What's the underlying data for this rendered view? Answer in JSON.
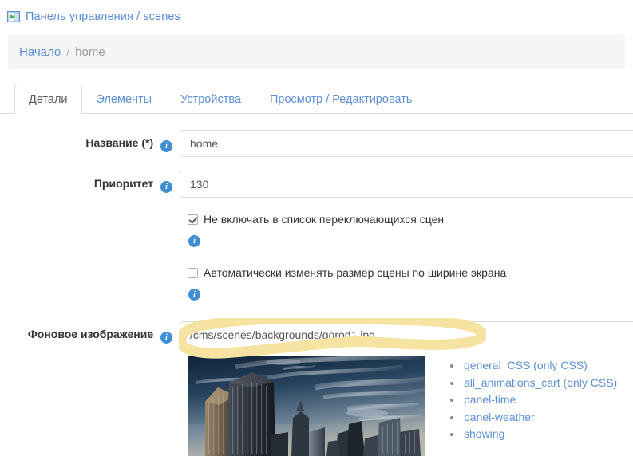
{
  "header": {
    "icon": "scene-panel-icon",
    "title_link": "Панель управления",
    "separator": "/",
    "title_current": "scenes"
  },
  "breadcrumb": {
    "home_label": "Начало",
    "separator": "/",
    "current": "home"
  },
  "tabs": [
    {
      "label": "Детали",
      "active": true
    },
    {
      "label": "Элементы",
      "active": false
    },
    {
      "label": "Устройства",
      "active": false
    },
    {
      "label": "Просмотр / Редактировать",
      "active": false
    }
  ],
  "form": {
    "name_field": {
      "label": "Название (*)",
      "info": "i",
      "value": "home",
      "placeholder": "home"
    },
    "priority_field": {
      "label": "Приоритет",
      "info": "i",
      "value": "130",
      "placeholder": "130"
    },
    "exclude_checkbox": {
      "label": "Не включать в список переключающихся сцен",
      "checked": true,
      "info": "i"
    },
    "autosize_checkbox": {
      "label": "Автоматически изменять размер сцены по ширине экрана",
      "checked": false,
      "info": "i"
    },
    "background_field": {
      "label": "Фоновое изображение",
      "info": "i",
      "value": "/cms/scenes/backgrounds/gorod1.jpg",
      "placeholder": "/cms/scenes/backgrounds/gorod1.jpg"
    }
  },
  "preview": {
    "image_alt": "city-skyline-thumbnail",
    "css_items": [
      "general_CSS (only CSS)",
      "all_animations_cart (only CSS)",
      "panel-time",
      "panel-weather",
      "showing"
    ]
  },
  "colors": {
    "link": "#5b8fd6",
    "highlight": "#f7e3a1",
    "info_icon": "#3e8fd4",
    "breadcrumb_bg": "#f5f5f5",
    "border": "#dddddd"
  }
}
